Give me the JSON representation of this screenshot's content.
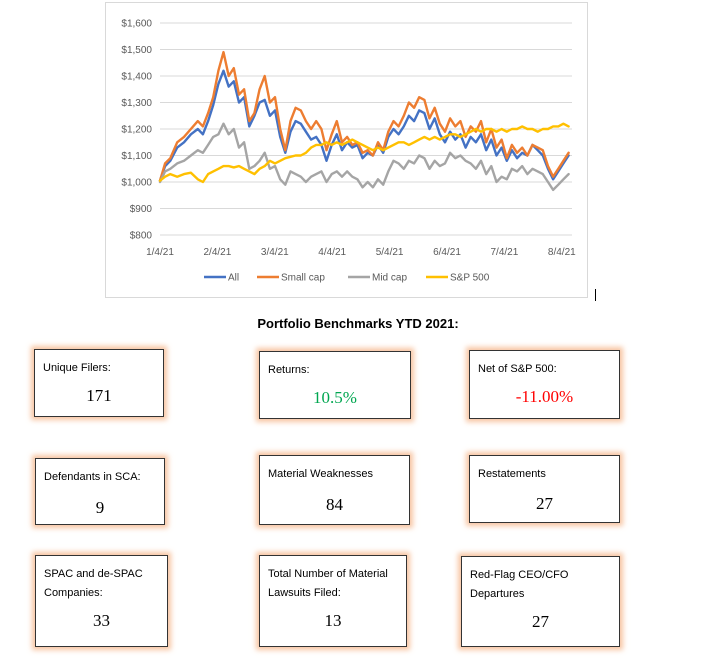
{
  "chart_data": {
    "type": "line",
    "y_ticks": [
      "$1,600",
      "$1,500",
      "$1,400",
      "$1,300",
      "$1,200",
      "$1,100",
      "$1,000",
      "$900",
      "$800"
    ],
    "ylim": [
      800,
      1600
    ],
    "x_ticks": [
      "1/4/21",
      "2/4/21",
      "3/4/21",
      "4/4/21",
      "5/4/21",
      "6/4/21",
      "7/4/21",
      "8/4/21"
    ],
    "grid": true,
    "legend_position": "bottom",
    "series": [
      {
        "name": "All",
        "color": "#4472c4",
        "x": [
          0,
          3,
          6,
          10,
          14,
          18,
          22,
          25,
          28,
          31,
          34,
          37,
          40,
          43,
          46,
          49,
          52,
          55,
          58,
          61,
          64,
          67,
          70,
          73,
          76,
          79,
          82,
          85,
          88,
          91,
          94,
          97,
          100,
          103,
          106,
          109,
          112,
          115,
          118,
          121,
          124,
          127,
          130,
          133,
          136,
          139,
          142,
          145,
          148,
          151,
          154,
          157,
          160,
          163,
          166,
          169,
          172,
          175,
          178,
          181,
          184,
          187,
          190,
          193,
          196,
          199,
          202,
          205,
          208,
          211,
          214,
          217,
          220,
          223,
          226,
          229,
          232,
          235,
          238
        ],
        "y": [
          1005,
          1060,
          1080,
          1130,
          1150,
          1180,
          1200,
          1180,
          1230,
          1290,
          1370,
          1420,
          1360,
          1380,
          1300,
          1320,
          1210,
          1250,
          1300,
          1310,
          1250,
          1270,
          1170,
          1110,
          1190,
          1230,
          1220,
          1190,
          1160,
          1170,
          1140,
          1080,
          1140,
          1180,
          1120,
          1150,
          1130,
          1140,
          1090,
          1110,
          1100,
          1140,
          1110,
          1170,
          1200,
          1180,
          1210,
          1250,
          1230,
          1270,
          1260,
          1200,
          1240,
          1180,
          1150,
          1190,
          1160,
          1180,
          1130,
          1170,
          1150,
          1180,
          1120,
          1160,
          1100,
          1130,
          1080,
          1120,
          1090,
          1110,
          1100,
          1140,
          1120,
          1100,
          1050,
          1010,
          1040,
          1070,
          1100
        ]
      },
      {
        "name": "Small cap",
        "color": "#ed7d31",
        "x": [
          0,
          3,
          6,
          10,
          14,
          18,
          22,
          25,
          28,
          31,
          34,
          37,
          40,
          43,
          46,
          49,
          52,
          55,
          58,
          61,
          64,
          67,
          70,
          73,
          76,
          79,
          82,
          85,
          88,
          91,
          94,
          97,
          100,
          103,
          106,
          109,
          112,
          115,
          118,
          121,
          124,
          127,
          130,
          133,
          136,
          139,
          142,
          145,
          148,
          151,
          154,
          157,
          160,
          163,
          166,
          169,
          172,
          175,
          178,
          181,
          184,
          187,
          190,
          193,
          196,
          199,
          202,
          205,
          208,
          211,
          214,
          217,
          220,
          223,
          226,
          229,
          232,
          235,
          238
        ],
        "y": [
          1005,
          1070,
          1090,
          1150,
          1170,
          1200,
          1230,
          1210,
          1260,
          1320,
          1420,
          1490,
          1400,
          1430,
          1330,
          1350,
          1230,
          1260,
          1350,
          1400,
          1300,
          1320,
          1200,
          1120,
          1230,
          1280,
          1270,
          1230,
          1200,
          1230,
          1200,
          1120,
          1180,
          1230,
          1150,
          1170,
          1140,
          1150,
          1110,
          1120,
          1100,
          1150,
          1120,
          1190,
          1230,
          1210,
          1250,
          1300,
          1280,
          1320,
          1310,
          1240,
          1280,
          1220,
          1190,
          1240,
          1210,
          1230,
          1170,
          1210,
          1190,
          1230,
          1150,
          1200,
          1130,
          1160,
          1090,
          1140,
          1110,
          1130,
          1100,
          1140,
          1130,
          1120,
          1060,
          1020,
          1050,
          1080,
          1110
        ]
      },
      {
        "name": "Mid cap",
        "color": "#a5a5a5",
        "x": [
          0,
          3,
          6,
          10,
          14,
          18,
          22,
          25,
          28,
          31,
          34,
          37,
          40,
          43,
          46,
          49,
          52,
          55,
          58,
          61,
          64,
          67,
          70,
          73,
          76,
          79,
          82,
          85,
          88,
          91,
          94,
          97,
          100,
          103,
          106,
          109,
          112,
          115,
          118,
          121,
          124,
          127,
          130,
          133,
          136,
          139,
          142,
          145,
          148,
          151,
          154,
          157,
          160,
          163,
          166,
          169,
          172,
          175,
          178,
          181,
          184,
          187,
          190,
          193,
          196,
          199,
          202,
          205,
          208,
          211,
          214,
          217,
          220,
          223,
          226,
          229,
          232,
          235,
          238
        ],
        "y": [
          1000,
          1040,
          1050,
          1070,
          1080,
          1100,
          1120,
          1110,
          1140,
          1170,
          1180,
          1220,
          1180,
          1200,
          1130,
          1150,
          1050,
          1060,
          1080,
          1110,
          1050,
          1060,
          1010,
          990,
          1040,
          1030,
          1020,
          1000,
          1020,
          1030,
          1040,
          1000,
          1030,
          1040,
          1020,
          1040,
          1020,
          1010,
          980,
          1000,
          980,
          1010,
          990,
          1040,
          1080,
          1070,
          1050,
          1080,
          1070,
          1100,
          1090,
          1050,
          1080,
          1060,
          1070,
          1110,
          1090,
          1100,
          1080,
          1070,
          1050,
          1080,
          1030,
          1060,
          1000,
          1020,
          1010,
          1050,
          1040,
          1060,
          1030,
          1050,
          1040,
          1030,
          1000,
          970,
          990,
          1010,
          1030
        ]
      },
      {
        "name": "S&P 500",
        "color": "#ffc000",
        "x": [
          0,
          3,
          6,
          10,
          14,
          18,
          22,
          25,
          28,
          31,
          34,
          37,
          40,
          43,
          46,
          49,
          52,
          55,
          58,
          61,
          64,
          67,
          70,
          73,
          76,
          79,
          82,
          85,
          88,
          91,
          94,
          97,
          100,
          103,
          106,
          109,
          112,
          115,
          118,
          121,
          124,
          127,
          130,
          133,
          136,
          139,
          142,
          145,
          148,
          151,
          154,
          157,
          160,
          163,
          166,
          169,
          172,
          175,
          178,
          181,
          184,
          187,
          190,
          193,
          196,
          199,
          202,
          205,
          208,
          211,
          214,
          217,
          220,
          223,
          226,
          229,
          232,
          235,
          238
        ],
        "y": [
          1005,
          1020,
          1030,
          1020,
          1030,
          1035,
          1010,
          1000,
          1030,
          1040,
          1050,
          1060,
          1060,
          1055,
          1060,
          1050,
          1040,
          1030,
          1050,
          1060,
          1080,
          1070,
          1080,
          1090,
          1095,
          1100,
          1100,
          1110,
          1130,
          1140,
          1140,
          1150,
          1140,
          1150,
          1140,
          1150,
          1160,
          1150,
          1140,
          1130,
          1120,
          1130,
          1120,
          1130,
          1140,
          1150,
          1150,
          1140,
          1150,
          1160,
          1170,
          1160,
          1170,
          1160,
          1170,
          1180,
          1180,
          1170,
          1180,
          1190,
          1200,
          1190,
          1200,
          1200,
          1190,
          1200,
          1190,
          1200,
          1200,
          1210,
          1200,
          1200,
          1190,
          1200,
          1200,
          1210,
          1210,
          1220,
          1210
        ]
      }
    ]
  },
  "title": "Portfolio Benchmarks YTD 2021:",
  "cards": [
    {
      "label": "Unique Filers:",
      "value": "171"
    },
    {
      "label": "Returns:",
      "value": "10.5%",
      "value_color": "#00a650"
    },
    {
      "label": "Net of S&P 500:",
      "value": "-11.00%",
      "value_color": "#ff0000"
    },
    {
      "label": "Defendants in SCA:",
      "value": "9"
    },
    {
      "label": "Material Weaknesses",
      "value": "84"
    },
    {
      "label": "Restatements",
      "value": "27"
    },
    {
      "label": "SPAC and de-SPAC Companies:",
      "value": "33"
    },
    {
      "label": "Total Number of Material Lawsuits Filed:",
      "value": "13"
    },
    {
      "label": "Red-Flag CEO/CFO Departures",
      "value": "27"
    }
  ]
}
